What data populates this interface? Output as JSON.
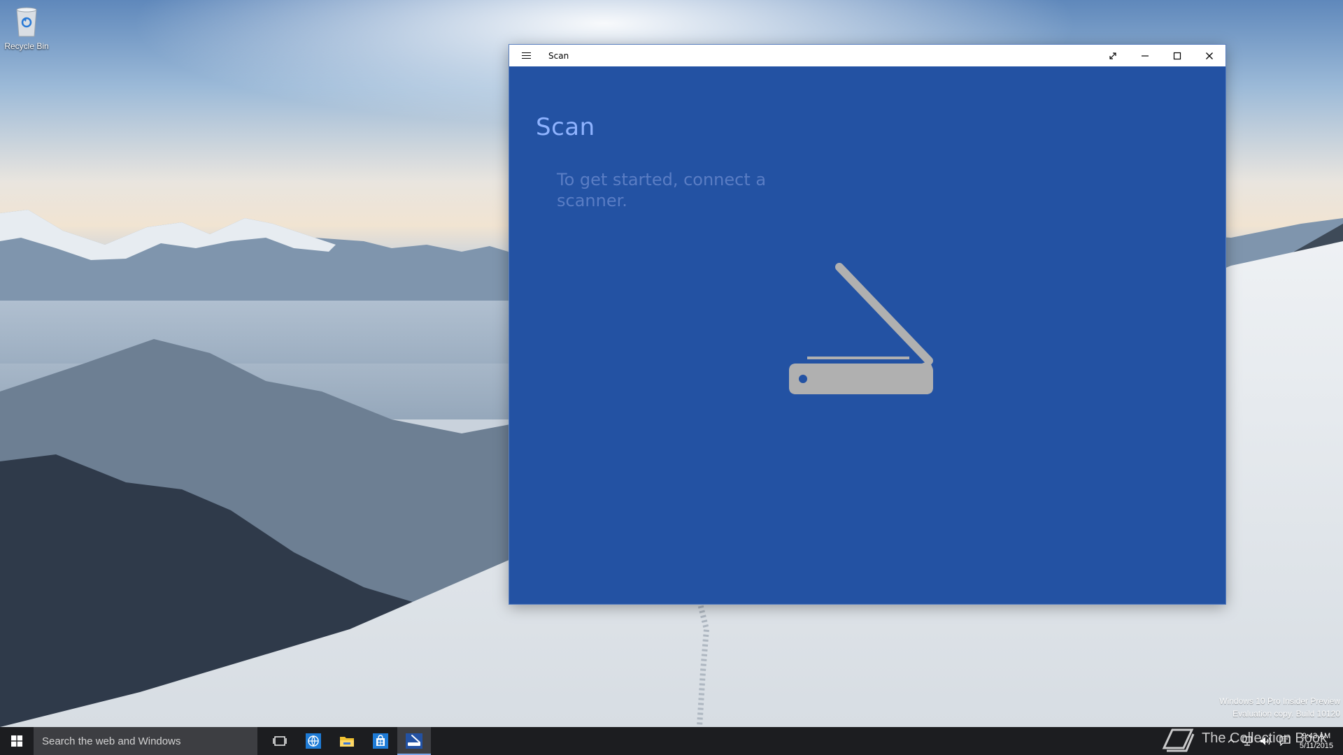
{
  "desktop": {
    "icons": [
      {
        "label": "Recycle Bin",
        "icon": "recycle-bin-icon"
      }
    ],
    "watermark": {
      "line1": "Windows 10 Pro Insider Preview",
      "line2": "Evaluation copy. Build 10120"
    },
    "brand": "The Collection Book"
  },
  "window": {
    "title": "Scan",
    "menu_icon": "hamburger-menu-icon",
    "buttons": [
      "fullscreen-icon",
      "minimize-icon",
      "maximize-icon",
      "close-icon"
    ],
    "background_color": "#2352a3",
    "app": {
      "heading": "Scan",
      "message": "To get started, connect a scanner.",
      "graphic_icon": "scanner-icon",
      "graphic_color": "#b0b0b0"
    }
  },
  "taskbar": {
    "start_icon": "windows-logo-icon",
    "search_placeholder": "Search the web and Windows",
    "apps": [
      {
        "name": "task-view",
        "icon": "task-view-icon"
      },
      {
        "name": "browser",
        "icon": "globe-icon"
      },
      {
        "name": "file-explorer",
        "icon": "folder-icon"
      },
      {
        "name": "store",
        "icon": "store-icon"
      },
      {
        "name": "scan",
        "icon": "scanner-icon",
        "active": true
      }
    ],
    "tray": {
      "icons": [
        "chevron-up-icon",
        "network-icon",
        "volume-icon",
        "action-center-icon"
      ],
      "time": "9:43 AM",
      "date": "5/11/2015"
    },
    "accent_color": "#7ea7e8"
  }
}
